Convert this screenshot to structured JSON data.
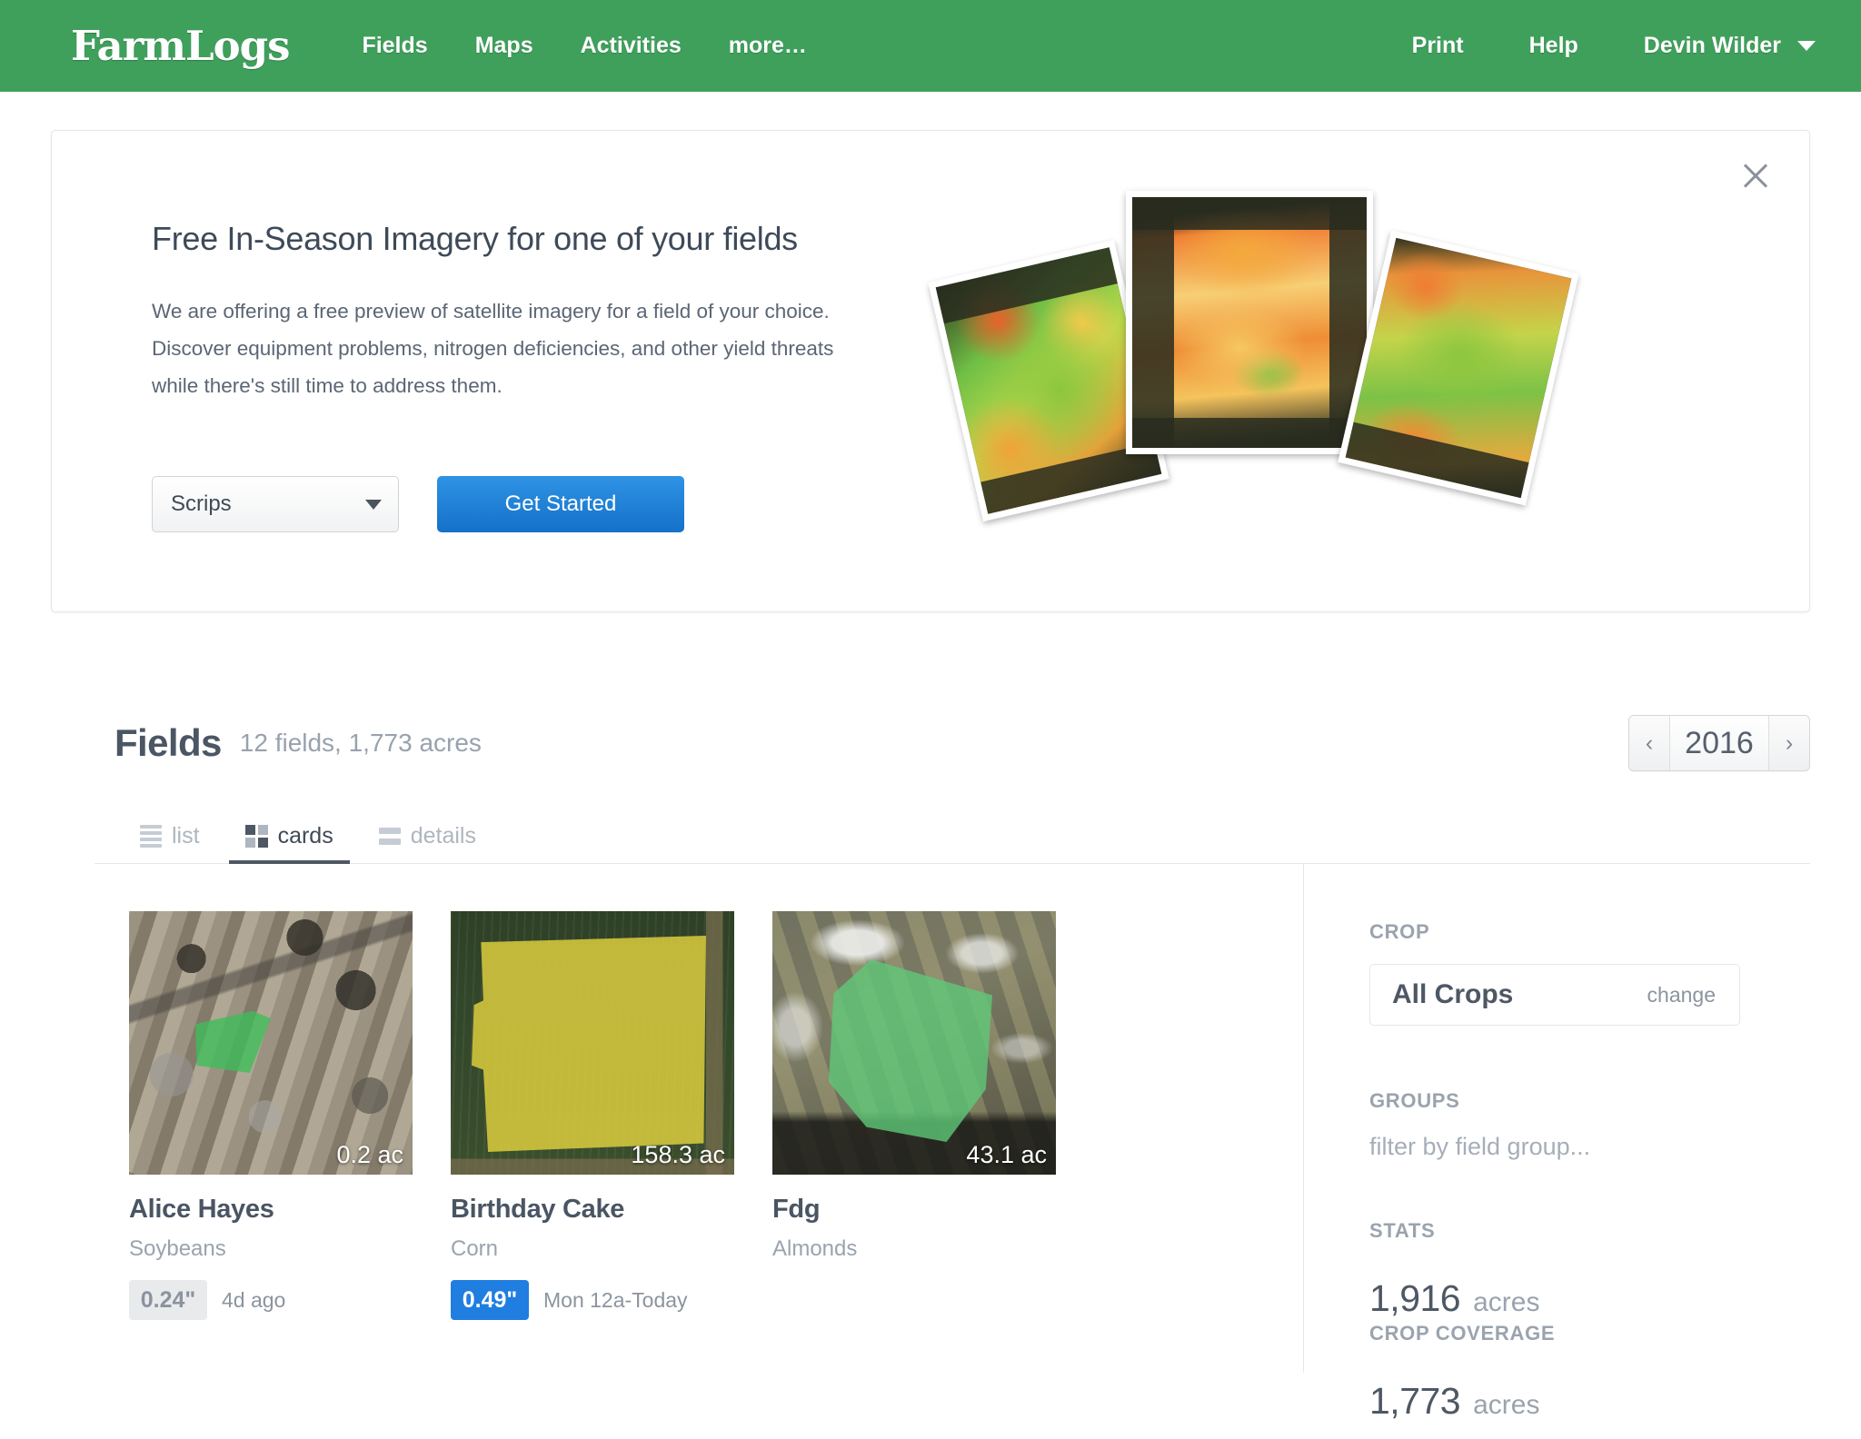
{
  "topnav": {
    "brand": "FarmLogs",
    "left_links": [
      {
        "label": "Fields"
      },
      {
        "label": "Maps"
      },
      {
        "label": "Activities"
      },
      {
        "label": "more…"
      }
    ],
    "right_links": [
      {
        "label": "Print"
      },
      {
        "label": "Help"
      }
    ],
    "user": "Devin Wilder",
    "caret_icon": "chevron-down-icon"
  },
  "promo": {
    "title": "Free In-Season Imagery for one of your fields",
    "body": "We are offering a free preview of satellite imagery for a field of your choice. Discover equipment problems, nitrogen deficiencies, and other yield threats while there's still time to address them.",
    "field_select_value": "Scrips",
    "cta_label": "Get Started",
    "close_icon": "close-icon",
    "imagery_alt": "ndvi-satellite-photos"
  },
  "fields": {
    "title": "Fields",
    "subtitle": "12 fields, 1,773 acres",
    "year": {
      "prev_label": "‹",
      "value": "2016",
      "next_label": "›"
    }
  },
  "view_tabs": [
    {
      "label": "list",
      "icon": "list-view-icon",
      "active": false
    },
    {
      "label": "cards",
      "icon": "cards-view-icon",
      "active": true
    },
    {
      "label": "details",
      "icon": "details-view-icon",
      "active": false
    }
  ],
  "cards": [
    {
      "name": "Alice Hayes",
      "crop": "Soybeans",
      "acres_label": "0.2 ac",
      "rain_amount": "0.24\"",
      "rain_when": "4d ago",
      "rain_badge_style": "gray"
    },
    {
      "name": "Birthday Cake",
      "crop": "Corn",
      "acres_label": "158.3 ac",
      "rain_amount": "0.49\"",
      "rain_when": "Mon 12a-Today",
      "rain_badge_style": "blue"
    },
    {
      "name": "Fdg",
      "crop": "Almonds",
      "acres_label": "43.1 ac",
      "rain_amount": "",
      "rain_when": "",
      "rain_badge_style": "none"
    }
  ],
  "sidebar": {
    "crop_label": "CROP",
    "crop_value": "All Crops",
    "crop_change": "change",
    "groups_label": "GROUPS",
    "groups_placeholder": "filter by field group...",
    "stats_label": "STATS",
    "stats": [
      {
        "number": "1,916",
        "unit": "acres",
        "caption": "CROP COVERAGE"
      },
      {
        "number": "1,773",
        "unit": "acres",
        "caption": ""
      }
    ]
  },
  "colors": {
    "brand_green": "#3fa05c",
    "accent_blue": "#1f7ee0",
    "text_dark": "#4e5864",
    "text_muted": "#9aa3ae"
  }
}
